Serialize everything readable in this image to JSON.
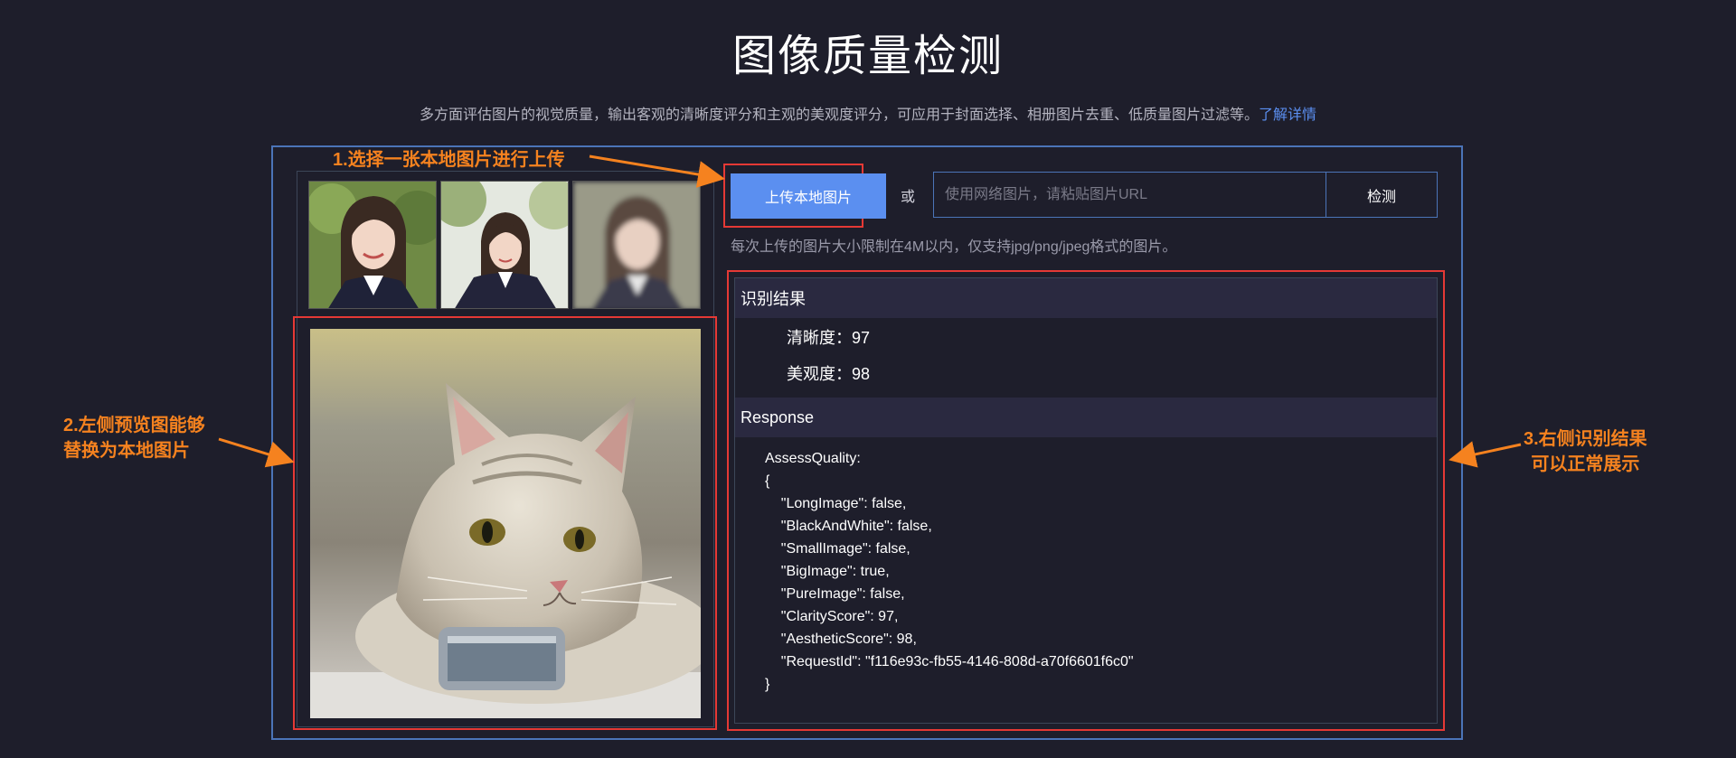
{
  "page": {
    "title": "图像质量检测",
    "subtitle": "多方面评估图片的视觉质量，输出客观的清晰度评分和主观的美观度评分，可应用于封面选择、相册图片去重、低质量图片过滤等。",
    "learn_more": "了解详情"
  },
  "thumbnails": [
    {
      "name": "sample-portrait-clear"
    },
    {
      "name": "sample-portrait-medium"
    },
    {
      "name": "sample-portrait-blurry"
    }
  ],
  "preview": {
    "subject": "cat-photo"
  },
  "upload": {
    "button_label": "上传本地图片",
    "or_label": "或",
    "url_placeholder": "使用网络图片，请粘贴图片URL",
    "url_value": "",
    "detect_label": "检测",
    "note": "每次上传的图片大小限制在4M以内，仅支持jpg/png/jpeg格式的图片。"
  },
  "result": {
    "section_title": "识别结果",
    "clarity_label": "清晰度：",
    "clarity_value": "97",
    "aesthetic_label": "美观度：",
    "aesthetic_value": "98",
    "response_title": "Response",
    "response_text": "AssessQuality:\n{\n    \"LongImage\": false,\n    \"BlackAndWhite\": false,\n    \"SmallImage\": false,\n    \"BigImage\": true,\n    \"PureImage\": false,\n    \"ClarityScore\": 97,\n    \"AestheticScore\": 98,\n    \"RequestId\": \"f116e93c-fb55-4146-808d-a70f6601f6c0\"\n}"
  },
  "annotations": {
    "step1": "1.选择一张本地图片进行上传",
    "step2_line1": "2.左侧预览图能够",
    "step2_line2": "替换为本地图片",
    "step3_line1": "3.右侧识别结果",
    "step3_line2": "可以正常展示"
  },
  "colors": {
    "background": "#1e1e2b",
    "accent": "#5b8ff0",
    "annotation": "#f5821f",
    "highlight_box": "#e53935",
    "panel_border": "#4b74b8"
  }
}
